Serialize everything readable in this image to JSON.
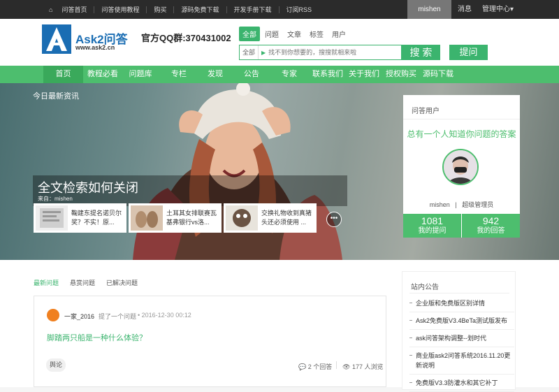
{
  "topbar": {
    "links": [
      "问答首页",
      "问答使用教程",
      "购买",
      "源码免费下载",
      "开发手册下载",
      "订阅RSS"
    ],
    "user": "mishen",
    "message": "消息",
    "admin": "管理中心▾"
  },
  "header": {
    "logo_text": "Ask2问答",
    "logo_url": "www.ask2.cn",
    "qq_group": "官方QQ群:370431002",
    "search_tabs": [
      "全部",
      "问题",
      "文章",
      "标签",
      "用户"
    ],
    "search_scope": "全部",
    "search_placeholder": "找不到你想要的，搜搜就相来啦",
    "search_button": "搜 索",
    "ask_button": "提问"
  },
  "nav": [
    "首页",
    "教程必看",
    "问题库",
    "专栏",
    "发现",
    "公告",
    "专家",
    "联系我们",
    "关于我们",
    "授权购买",
    "源码下载"
  ],
  "banner": {
    "section_title": "今日最新资讯",
    "headline": "全文检索如何关闭",
    "source": "来自：mishen",
    "thumbs": [
      {
        "text": "鞠建东提名诺贝尔奖？不实！原..."
      },
      {
        "text": "土耳其女排联赛瓦基弗银行vs洛..."
      },
      {
        "text": "交换礼物收到真猪头还必须使用 ..."
      }
    ],
    "more": "•••"
  },
  "user_card": {
    "header": "问答用户",
    "slogan": "总有一个人知道你问题的答案",
    "name": "mishen",
    "divider": "|",
    "role": "超级管理员",
    "stats": [
      {
        "number": "1081",
        "label": "我的提问"
      },
      {
        "number": "942",
        "label": "我的回答"
      }
    ]
  },
  "question_tabs": [
    "最新问题",
    "悬赏问题",
    "已解决问题"
  ],
  "question": {
    "author": "一家_2016",
    "action": "提了一个问题",
    "time": "2016-12-30 00:12",
    "title": "脚踏两只船是一种什么体验？",
    "tag": "舆论",
    "answers": "2 个回答",
    "views": "177 人浏览"
  },
  "notices": {
    "header": "站内公告",
    "items": [
      "企业版和免费版区别详情",
      "Ask2免费版V3.4BeTa测试版发布",
      "ask问答架构调整--划时代",
      "商业版ask2问答系统2016.11.20更新说明",
      "免费版V3.3防灌水和其它补丁"
    ]
  },
  "colors": {
    "accent": "#4dbe6e",
    "topbar": "#2b2b2b",
    "logo_blue": "#1a6db3"
  }
}
